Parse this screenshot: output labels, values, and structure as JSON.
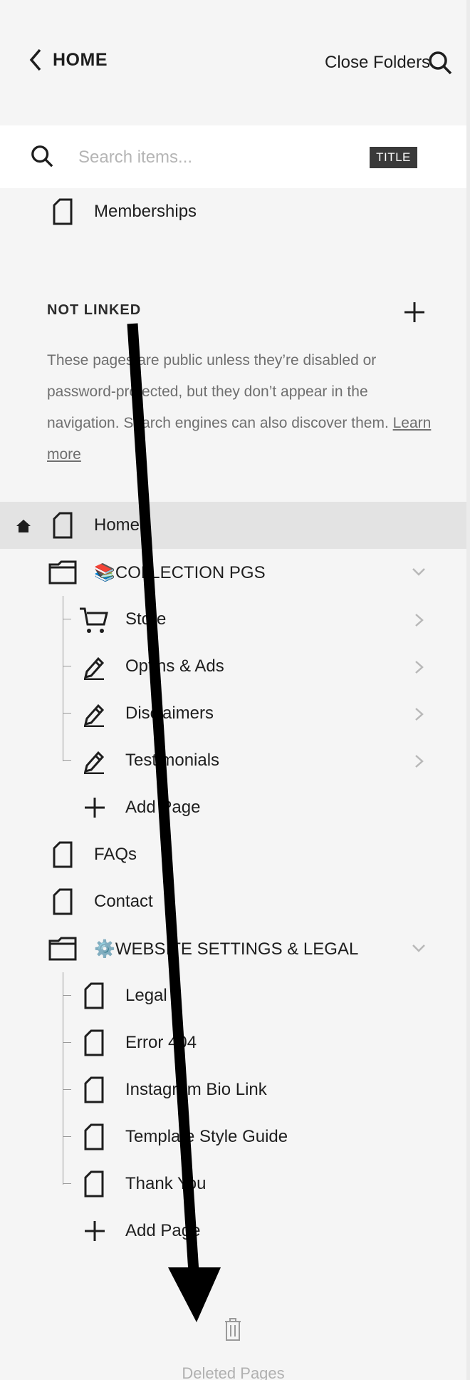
{
  "header": {
    "back_label": "HOME",
    "close_folders_label": "Close Folders"
  },
  "search": {
    "placeholder": "Search items...",
    "badge": "TITLE"
  },
  "top_items": [
    {
      "label": "Memberships",
      "icon": "page-icon"
    }
  ],
  "not_linked": {
    "heading": "NOT LINKED",
    "description": "These pages are public unless they’re disabled or password-protected, but they don’t appear in the navigation. Search engines can also discover them.",
    "learn_more": "Learn more"
  },
  "tree": {
    "home": "Home",
    "collection_folder": {
      "emoji": "📚",
      "label": "COLLECTION PGS"
    },
    "collection_items": [
      "Store",
      "Optins & Ads",
      "Disclaimers",
      "Testimonials"
    ],
    "add_page_1": "Add Page",
    "faqs": "FAQs",
    "contact": "Contact",
    "settings_folder": {
      "emoji": "⚙️",
      "label": "WEBSITE SETTINGS & LEGAL"
    },
    "settings_items": [
      "Legal",
      "Error 404",
      "Instagram Bio Link",
      "Template Style Guide",
      "Thank You"
    ],
    "add_page_2": "Add Page"
  },
  "footer": {
    "deleted_label": "Deleted Pages"
  },
  "colors": {
    "panel_bg": "#f5f5f5",
    "selected_row": "#e3e3e3",
    "badge_bg": "#3a3a3a",
    "edge_accent": "#7a1f35",
    "annotation_arrow": "#000000"
  }
}
